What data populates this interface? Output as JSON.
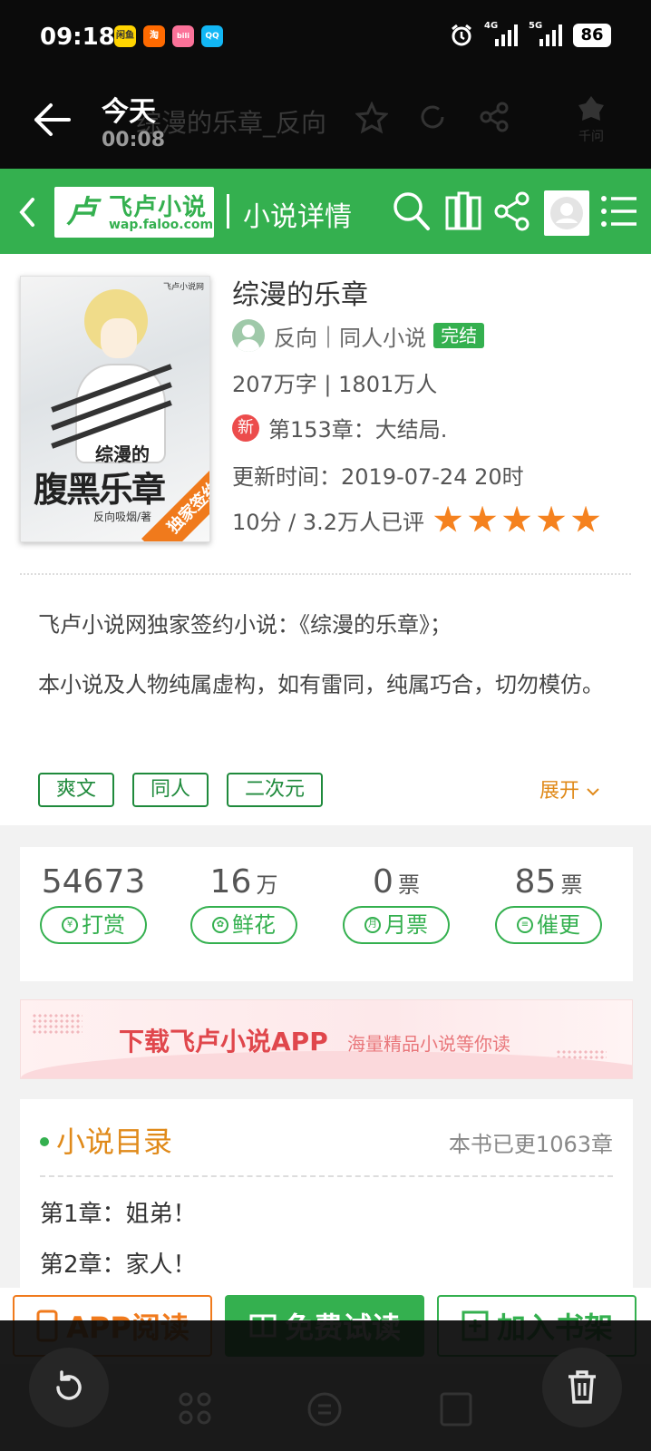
{
  "status_bar": {
    "time": "09:18",
    "apps": [
      {
        "name": "闲鱼",
        "color": "#ffd400",
        "fg": "#333"
      },
      {
        "name": "淘",
        "color": "#ff6a00",
        "fg": "#fff"
      },
      {
        "name": "bili",
        "color": "#fb7299",
        "fg": "#fff"
      },
      {
        "name": "QQ",
        "color": "#12b7f5",
        "fg": "#fff"
      }
    ],
    "network_1": "4G",
    "network_2": "5G",
    "battery": "86"
  },
  "browser_header": {
    "page_title": "综漫的乐章_反向",
    "label": "今天",
    "elapsed": "00:08",
    "assistant_label": "千问"
  },
  "site_nav": {
    "logo_mark": "卢",
    "logo_name": "飞卢小说",
    "logo_url": "wap.faloo.com",
    "title": "小说详情"
  },
  "book": {
    "title": "综漫的乐章",
    "author": "反向",
    "category": "同人小说",
    "status": "完结",
    "stats_line": "207万字 | 1801万人",
    "new_badge": "新",
    "latest_chapter": "第153章：大结局.",
    "update_time": "更新时间：2019-07-24 20时",
    "rating_text": "10分 / 3.2万人已评",
    "rating_stars": 5,
    "cover": {
      "subtitle": "综漫的",
      "main": "腹黑乐章",
      "author": "反向吸烟/著",
      "tag": "独家签约",
      "logo": "飞卢小说网"
    }
  },
  "intro": {
    "line1": "飞卢小说网独家签约小说：《综漫的乐章》；",
    "line2": "本小说及人物纯属虚构，如有雷同，纯属巧合，切勿模仿。"
  },
  "tags": [
    "爽文",
    "同人",
    "二次元"
  ],
  "expand_label": "展开",
  "stats": [
    {
      "value": "54673",
      "unit": "",
      "label": "打赏",
      "icon": "¥"
    },
    {
      "value": "16",
      "unit": "万",
      "label": "鲜花",
      "icon": "✿"
    },
    {
      "value": "0",
      "unit": "票",
      "label": "月票",
      "icon": "月"
    },
    {
      "value": "85",
      "unit": "票",
      "label": "催更",
      "icon": "≡"
    }
  ],
  "banner": {
    "main": "下载飞卢小说APP",
    "sub": "海量精品小说等你读"
  },
  "toc": {
    "title": "小说目录",
    "count": "本书已更1063章",
    "chapters": [
      "第1章：姐弟！",
      "第2章：家人！"
    ]
  },
  "actions": {
    "app_read": "APP阅读",
    "free_read": "免费试读",
    "add_shelf": "加入书架"
  },
  "colors": {
    "brand_green": "#34b04f",
    "accent_orange": "#f07a1c",
    "banner_red": "#e0474c"
  }
}
